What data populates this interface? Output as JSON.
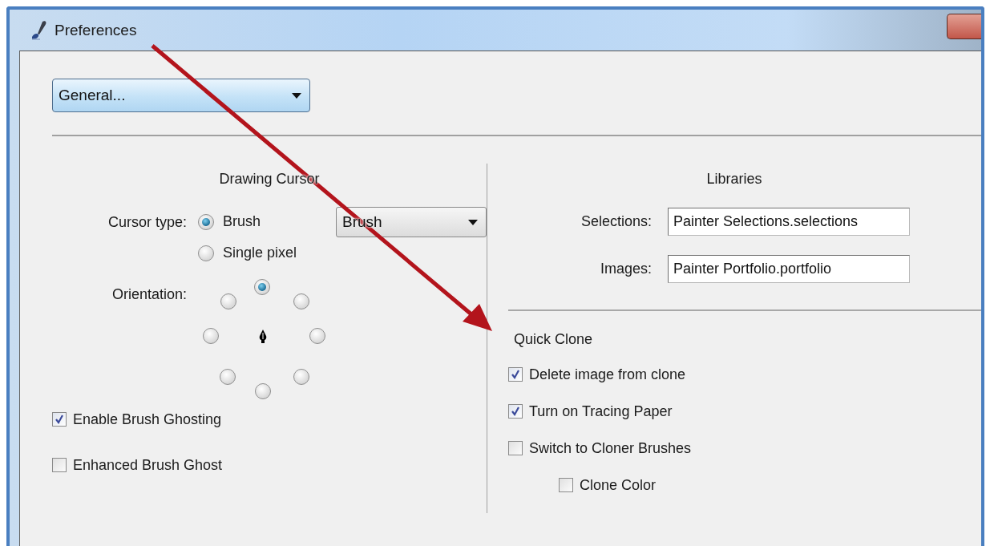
{
  "window": {
    "title": "Preferences"
  },
  "category_dropdown": {
    "value": "General..."
  },
  "drawing_cursor": {
    "title": "Drawing Cursor",
    "cursor_type": {
      "label": "Cursor type:",
      "options": [
        {
          "label": "Brush",
          "selected": true
        },
        {
          "label": "Single pixel",
          "selected": false
        }
      ],
      "dropdown": {
        "value": "Brush"
      }
    },
    "orientation": {
      "label": "Orientation:",
      "options": [
        {
          "selected": true
        },
        {
          "selected": false
        },
        {
          "selected": false
        },
        {
          "selected": false
        },
        {
          "selected": false
        },
        {
          "selected": false
        },
        {
          "selected": false
        },
        {
          "selected": false
        }
      ]
    },
    "checkboxes": [
      {
        "label": "Enable Brush Ghosting",
        "checked": true
      },
      {
        "label": "Enhanced Brush Ghost",
        "checked": false
      }
    ]
  },
  "libraries": {
    "title": "Libraries",
    "fields": [
      {
        "label": "Selections:",
        "value": "Painter Selections.selections"
      },
      {
        "label": "Images:",
        "value": "Painter Portfolio.portfolio"
      }
    ]
  },
  "quick_clone": {
    "title": "Quick Clone",
    "checkboxes": [
      {
        "label": "Delete image from clone",
        "checked": true
      },
      {
        "label": "Turn on Tracing Paper",
        "checked": true
      },
      {
        "label": "Switch to Cloner Brushes",
        "checked": false,
        "children": [
          {
            "label": "Clone Color",
            "checked": false
          }
        ]
      }
    ]
  }
}
